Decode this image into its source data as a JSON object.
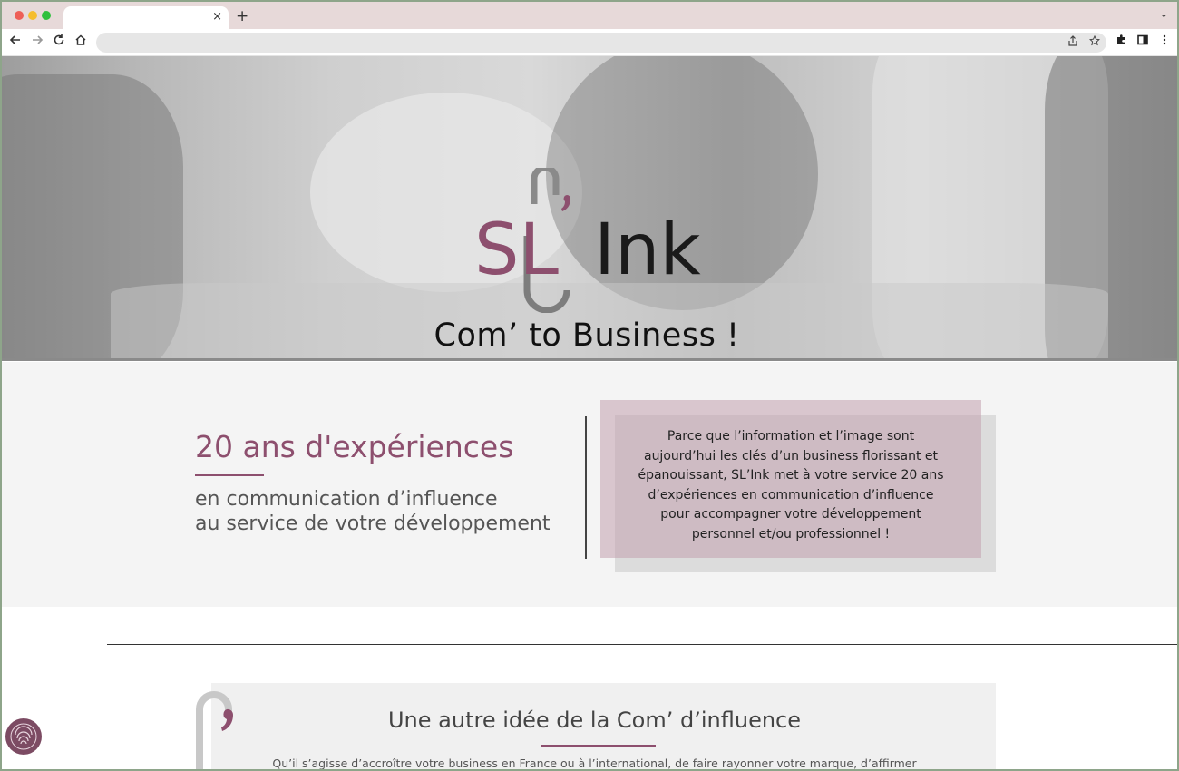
{
  "browser": {
    "tab_close": "×",
    "new_tab": "+",
    "tab_menu": "⌄",
    "icons": [
      "back-icon",
      "forward-icon",
      "reload-icon",
      "home-icon",
      "share-icon",
      "star-icon",
      "extensions-icon",
      "sidepanel-icon",
      "menu-icon"
    ]
  },
  "hero": {
    "logo_text_sl": "SL",
    "logo_text_ink": "Ink",
    "tagline": "Com’ to Business !"
  },
  "experience": {
    "title": "20 ans d'expériences",
    "subtitle_line1": "en communication d’influence",
    "subtitle_line2": "au service de votre développement",
    "card_lines": [
      "Parce que l’information et l’image sont",
      "aujourd’hui les clés d’un business florissant et",
      "épanouissant, SL’Ink met à votre service 20 ans",
      "d’expériences en communication d’influence",
      "pour accompagner votre développement",
      "personnel et/ou professionnel !"
    ]
  },
  "idea": {
    "title": "Une autre idée de la Com’ d’influence",
    "text": "Qu’il s’agisse d’accroître votre business en France ou à l’international, de faire rayonner votre marque, d’affirmer"
  },
  "colors": {
    "brand": "#8d4f6e",
    "card": "#c2a0ae",
    "tabbar": "#e7d9d9"
  }
}
